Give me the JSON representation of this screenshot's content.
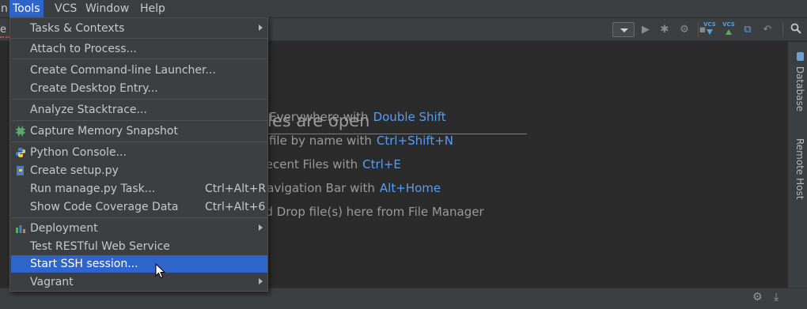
{
  "menubar": {
    "items": [
      {
        "label": "n"
      },
      {
        "label": "Tools"
      },
      {
        "label": "VCS"
      },
      {
        "label": "Window"
      },
      {
        "label": "Help"
      }
    ]
  },
  "editor_tab": {
    "label": "e"
  },
  "editor": {
    "empty_title": "les are open",
    "hints": [
      {
        "text": "n Everywhere with",
        "key": "Double Shift"
      },
      {
        "text": "a file by name with",
        "key": "Ctrl+Shift+N"
      },
      {
        "text": "Recent Files with",
        "key": "Ctrl+E"
      },
      {
        "text": "Navigation Bar with",
        "key": "Alt+Home"
      },
      {
        "text": "nd Drop file(s) here from File Manager",
        "key": ""
      }
    ]
  },
  "right_strip": {
    "tabs": [
      "Database",
      "Remote Host"
    ]
  },
  "toolbar": {
    "vcs_update_label": "VCS",
    "vcs_commit_label": "VCS"
  },
  "tools_menu": {
    "items": [
      {
        "label": "Tasks & Contexts",
        "shortcut": "",
        "submenu": true,
        "icon": ""
      },
      {
        "label": "Attach to Process...",
        "shortcut": "",
        "submenu": false,
        "icon": ""
      },
      {
        "label": "Create Command-line Launcher...",
        "shortcut": "",
        "submenu": false,
        "icon": ""
      },
      {
        "label": "Create Desktop Entry...",
        "shortcut": "",
        "submenu": false,
        "icon": ""
      },
      {
        "label": "Analyze Stacktrace...",
        "shortcut": "",
        "submenu": false,
        "icon": ""
      },
      {
        "label": "Capture Memory Snapshot",
        "shortcut": "",
        "submenu": false,
        "icon": "memory-chip-icon"
      },
      {
        "label": "Python Console...",
        "shortcut": "",
        "submenu": false,
        "icon": "python-icon"
      },
      {
        "label": "Create setup.py",
        "shortcut": "",
        "submenu": false,
        "icon": "python-file-icon"
      },
      {
        "label": "Run manage.py Task...",
        "shortcut": "Ctrl+Alt+R",
        "submenu": false,
        "icon": ""
      },
      {
        "label": "Show Code Coverage Data",
        "shortcut": "Ctrl+Alt+6",
        "submenu": false,
        "icon": ""
      },
      {
        "label": "Deployment",
        "shortcut": "",
        "submenu": true,
        "icon": "deployment-icon"
      },
      {
        "label": "Test RESTful Web Service",
        "shortcut": "",
        "submenu": false,
        "icon": ""
      },
      {
        "label": "Start SSH session...",
        "shortcut": "",
        "submenu": false,
        "icon": "",
        "selected": true
      },
      {
        "label": "Vagrant",
        "shortcut": "",
        "submenu": true,
        "icon": ""
      }
    ]
  },
  "colors": {
    "selection": "#2f65ca",
    "link_key": "#589df6",
    "menu_bg": "#3c3f41",
    "editor_bg": "#2b2b2b"
  }
}
